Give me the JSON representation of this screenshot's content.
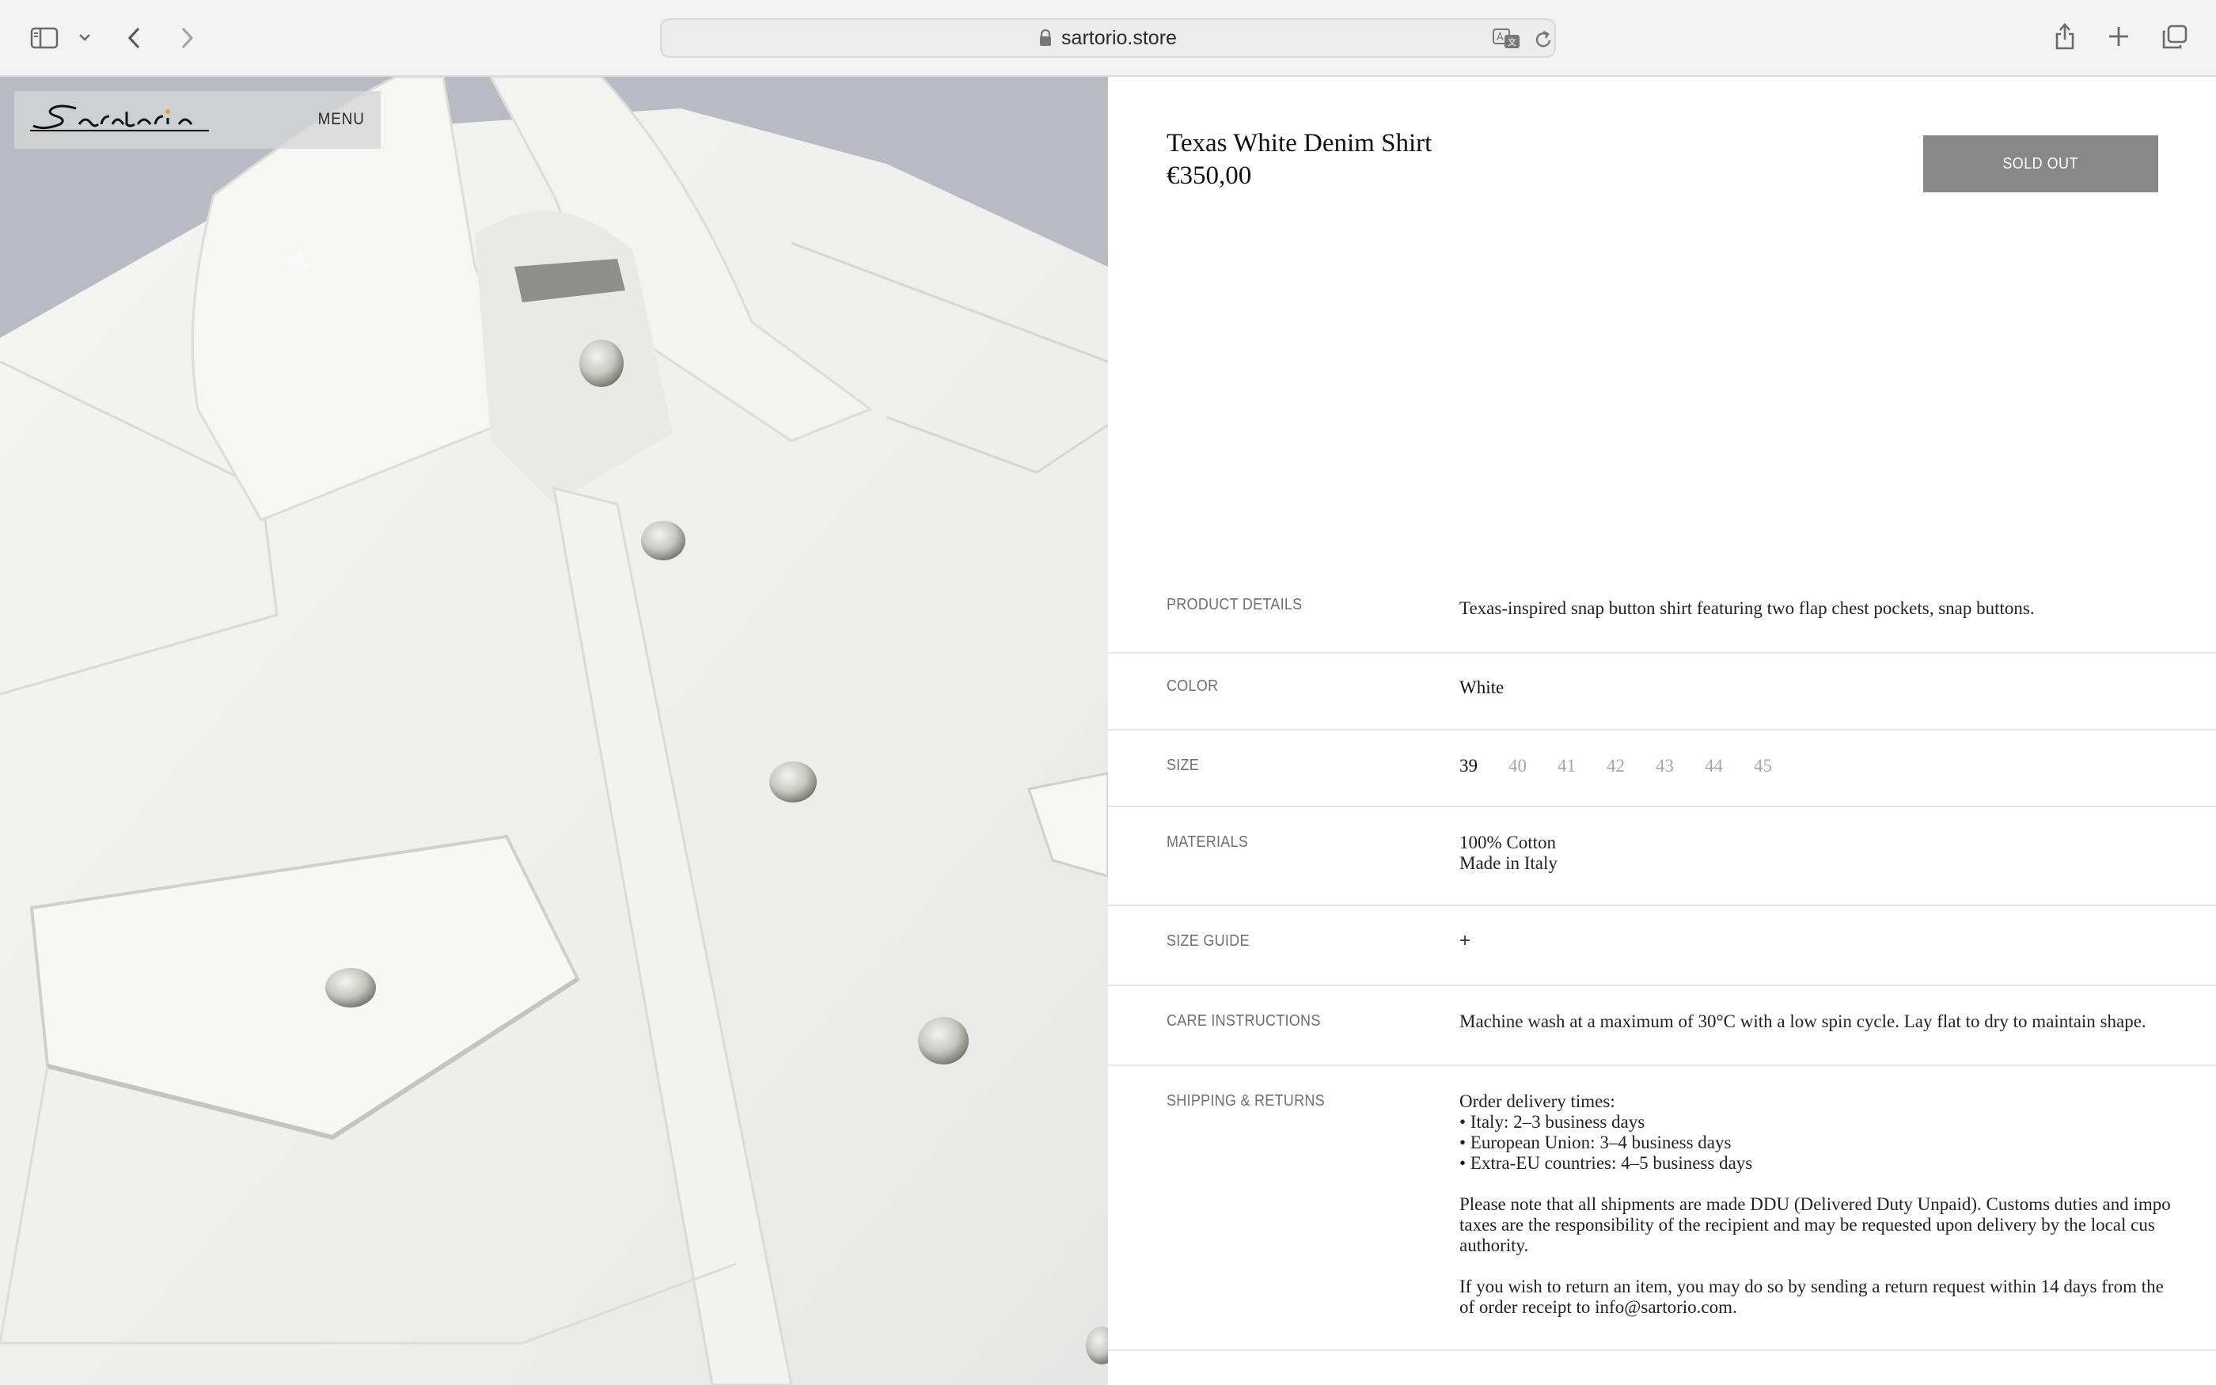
{
  "browser": {
    "url": "sartorio.store",
    "icons": [
      "sidebar-icon",
      "chevron-down-icon",
      "back-icon",
      "forward-icon",
      "lock-icon",
      "translate-icon",
      "reload-icon",
      "share-icon",
      "new-tab-icon",
      "tabs-overview-icon"
    ]
  },
  "site": {
    "brand": "Sartorio",
    "menu_label": "MENU"
  },
  "product": {
    "title": "Texas White Denim Shirt",
    "price": "€350,00",
    "sold_out_label": "SOLD OUT",
    "sold_out_color": "#888888"
  },
  "details": {
    "product_details": {
      "label": "PRODUCT DETAILS",
      "value": "Texas-inspired snap button shirt featuring two flap chest pockets, snap buttons."
    },
    "color": {
      "label": "COLOR",
      "value": "White"
    },
    "size": {
      "label": "SIZE",
      "options": [
        "39",
        "40",
        "41",
        "42",
        "43",
        "44",
        "45"
      ],
      "selected": "39"
    },
    "materials": {
      "label": "MATERIALS",
      "lines": [
        "100% Cotton",
        "Made in Italy"
      ]
    },
    "size_guide": {
      "label": "SIZE GUIDE",
      "toggle": "+"
    },
    "care": {
      "label": "CARE INSTRUCTIONS",
      "value": "Machine wash at a maximum of 30°C with a low spin cycle. Lay flat to dry to maintain shape."
    },
    "shipping": {
      "label": "SHIPPING & RETURNS",
      "delivery_heading": "Order delivery times:",
      "delivery_lines": [
        "• Italy: 2–3 business days",
        "• European Union: 3–4 business days",
        "• Extra-EU countries: 4–5 business days"
      ],
      "ddu_lines": [
        "Please note that all shipments are made DDU (Delivered Duty Unpaid). Customs duties and impo",
        "taxes are the responsibility of the recipient and may be requested upon delivery by the local cus",
        "authority."
      ],
      "return_lines": [
        "If you wish to return an item, you may do so by sending a return request within 14 days from the",
        "of order receipt to info@sartorio.com."
      ]
    }
  }
}
